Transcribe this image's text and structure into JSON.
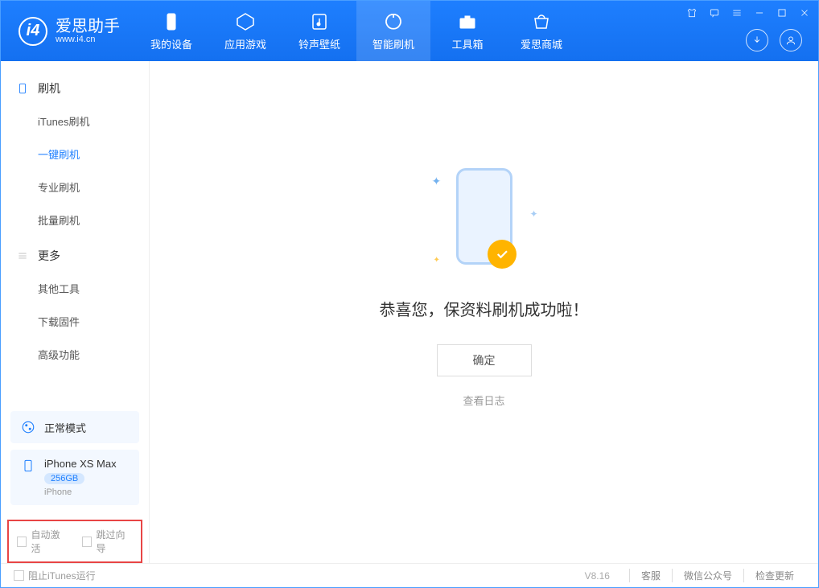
{
  "app": {
    "name": "爱思助手",
    "url": "www.i4.cn"
  },
  "nav": [
    {
      "label": "我的设备"
    },
    {
      "label": "应用游戏"
    },
    {
      "label": "铃声壁纸"
    },
    {
      "label": "智能刷机"
    },
    {
      "label": "工具箱"
    },
    {
      "label": "爱思商城"
    }
  ],
  "sidebar": {
    "section1": {
      "title": "刷机",
      "items": [
        "iTunes刷机",
        "一键刷机",
        "专业刷机",
        "批量刷机"
      ]
    },
    "section2": {
      "title": "更多",
      "items": [
        "其他工具",
        "下载固件",
        "高级功能"
      ]
    }
  },
  "mode": {
    "label": "正常模式"
  },
  "device": {
    "name": "iPhone XS Max",
    "storage": "256GB",
    "type": "iPhone"
  },
  "options": {
    "opt1": "自动激活",
    "opt2": "跳过向导"
  },
  "main": {
    "success": "恭喜您，保资料刷机成功啦！",
    "ok": "确定",
    "log": "查看日志"
  },
  "footer": {
    "block_itunes": "阻止iTunes运行",
    "version": "V8.16",
    "service": "客服",
    "wechat": "微信公众号",
    "update": "检查更新"
  }
}
